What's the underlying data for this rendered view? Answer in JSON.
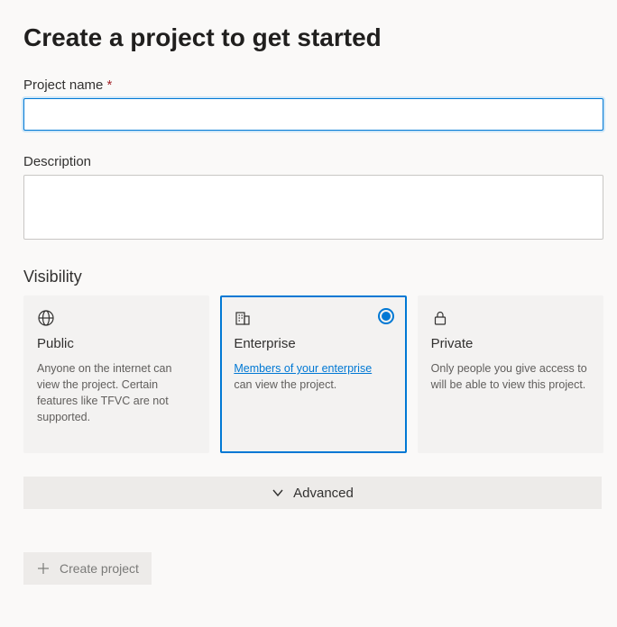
{
  "title": "Create a project to get started",
  "projectName": {
    "label": "Project name",
    "required": "*",
    "value": ""
  },
  "description": {
    "label": "Description",
    "value": ""
  },
  "visibility": {
    "label": "Visibility",
    "selected": "enterprise",
    "options": {
      "public": {
        "title": "Public",
        "desc": "Anyone on the internet can view the project. Certain features like TFVC are not supported."
      },
      "enterprise": {
        "title": "Enterprise",
        "linkText": "Members of your enterprise",
        "descSuffix": " can view the project."
      },
      "private": {
        "title": "Private",
        "desc": "Only people you give access to will be able to view this project."
      }
    }
  },
  "advanced": {
    "label": "Advanced"
  },
  "createButton": {
    "label": "Create project"
  }
}
